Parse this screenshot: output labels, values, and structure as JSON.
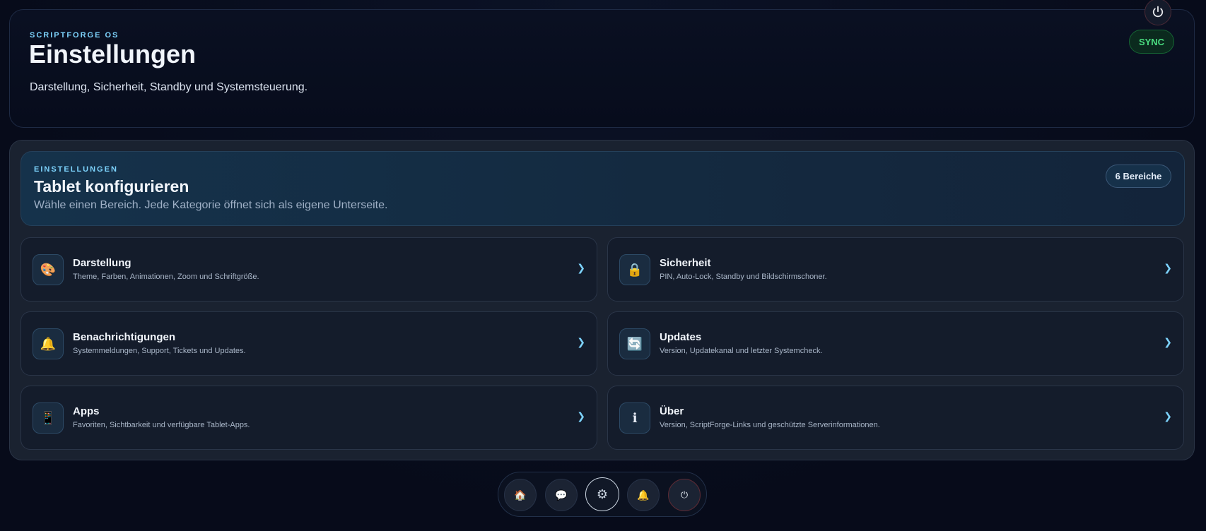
{
  "header": {
    "brand": "SCRIPTFORGE OS",
    "title": "Einstellungen",
    "subtitle": "Darstellung, Sicherheit, Standby und Systemsteuerung.",
    "sync_label": "SYNC"
  },
  "hero": {
    "kicker": "EINSTELLUNGEN",
    "title": "Tablet konfigurieren",
    "subtitle": "Wähle einen Bereich. Jede Kategorie öffnet sich als eigene Unterseite.",
    "badge": "6 Bereiche"
  },
  "categories": [
    {
      "title": "Darstellung",
      "desc": "Theme, Farben, Animationen, Zoom und Schriftgröße.",
      "icon": "palette-icon",
      "glyph": "🎨"
    },
    {
      "title": "Sicherheit",
      "desc": "PIN, Auto-Lock, Standby und Bildschirmschoner.",
      "icon": "lock-icon",
      "glyph": "🔒"
    },
    {
      "title": "Benachrichtigungen",
      "desc": "Systemmeldungen, Support, Tickets und Updates.",
      "icon": "bell-icon",
      "glyph": "🔔"
    },
    {
      "title": "Updates",
      "desc": "Version, Updatekanal und letzter Systemcheck.",
      "icon": "refresh-icon",
      "glyph": "🔄"
    },
    {
      "title": "Apps",
      "desc": "Favoriten, Sichtbarkeit und verfügbare Tablet-Apps.",
      "icon": "apps-icon",
      "glyph": "📱"
    },
    {
      "title": "Über",
      "desc": "Version, ScriptForge-Links und geschützte Serverinformationen.",
      "icon": "info-icon",
      "glyph": "ℹ"
    }
  ],
  "chevron": "❯",
  "dock": [
    {
      "icon": "home-icon",
      "glyph": "🏠"
    },
    {
      "icon": "chat-icon",
      "glyph": "💬"
    },
    {
      "icon": "gear-icon",
      "glyph": "⚙"
    },
    {
      "icon": "bell-icon",
      "glyph": "🔔"
    },
    {
      "icon": "power-icon",
      "glyph": "⏻"
    }
  ],
  "colors": {
    "accent": "#7dd3fc",
    "sync": "#4ade80",
    "background": "#070b1a"
  }
}
